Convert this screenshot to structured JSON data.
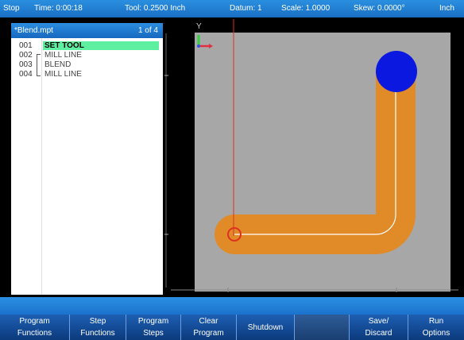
{
  "status": {
    "mode": "Stop",
    "time": "Time: 0:00:18",
    "tool": "Tool: 0.2500 Inch",
    "datum": "Datum: 1",
    "scale": "Scale: 1.0000",
    "skew": "Skew: 0.0000°",
    "units": "Inch"
  },
  "program": {
    "filename": "*Blend.mpt",
    "pager": "1 of 4",
    "steps": [
      {
        "num": "001",
        "label": "SET TOOL",
        "selected": true
      },
      {
        "num": "002",
        "label": "MILL LINE",
        "selected": false
      },
      {
        "num": "003",
        "label": "BLEND",
        "selected": false
      },
      {
        "num": "004",
        "label": "MILL LINE",
        "selected": false
      }
    ]
  },
  "canvas": {
    "axis_y_label": "Y",
    "colors": {
      "workpiece": "#a7a7a7",
      "toolpath": "#e08a28",
      "tool": "#0a18e0",
      "cursor": "#e03020"
    }
  },
  "softkeys": [
    {
      "label": "Program\nFunctions"
    },
    {
      "label": "Step\nFunctions"
    },
    {
      "label": "Program\nSteps"
    },
    {
      "label": "Clear\nProgram"
    },
    {
      "label": "Shutdown"
    },
    {
      "label": ""
    },
    {
      "label": "Save/\nDiscard"
    },
    {
      "label": "Run\nOptions"
    }
  ]
}
